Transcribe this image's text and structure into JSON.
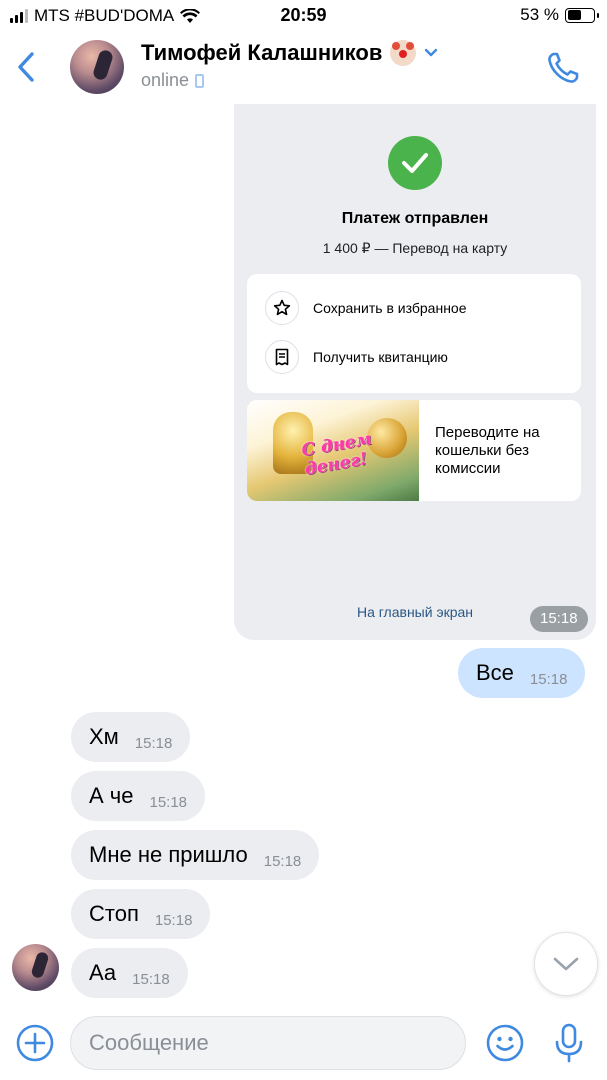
{
  "status_bar": {
    "carrier": "MTS #BUD'DOMA",
    "time": "20:59",
    "battery": "53 %",
    "battery_level": 0.53
  },
  "header": {
    "contact_name": "Тимофей Калашников",
    "status": "online",
    "icons": [
      "back-icon",
      "clown-emoji-icon",
      "chevron-down-icon",
      "phone-icon",
      "call-icon"
    ]
  },
  "payment_card": {
    "title": "Платеж отправлен",
    "subtitle": "1 400 ₽ — Перевод на карту",
    "actions": [
      {
        "label": "Сохранить в избранное",
        "icon": "star-icon"
      },
      {
        "label": "Получить квитанцию",
        "icon": "receipt-icon"
      }
    ],
    "promo": {
      "banner_text": "С днем денег!",
      "text": "Переводите на кошельки без комиссии"
    },
    "home_link": "На главный экран",
    "time": "15:18"
  },
  "messages": [
    {
      "direction": "out",
      "text": "Все",
      "time": "15:18"
    },
    {
      "direction": "in",
      "text": "Хм",
      "time": "15:18"
    },
    {
      "direction": "in",
      "text": "А че",
      "time": "15:18"
    },
    {
      "direction": "in",
      "text": "Мне не пришло",
      "time": "15:18"
    },
    {
      "direction": "in",
      "text": "Стоп",
      "time": "15:18"
    },
    {
      "direction": "in",
      "text": "Аа",
      "time": "15:18"
    }
  ],
  "composer": {
    "placeholder": "Сообщение",
    "value": "",
    "icons": [
      "add-icon",
      "smile-icon",
      "microphone-icon"
    ]
  },
  "colors": {
    "accent": "#3f8ae0",
    "outgoing_bubble": "#cce4ff",
    "incoming_bubble": "#ebedf0",
    "success": "#4bb34b",
    "link": "#2a5885"
  }
}
